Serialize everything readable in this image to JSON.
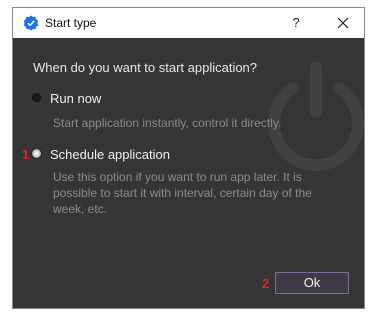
{
  "window": {
    "title": "Start type",
    "help_label": "?"
  },
  "dialog": {
    "question": "When do you want to start application?",
    "options": [
      {
        "label": "Run now",
        "description": "Start  application instantly, control it directly.",
        "selected": false
      },
      {
        "label": "Schedule application",
        "description": "Use this option if you want to run app later. It is possible to start it with interval, certain day of the week, etc.",
        "selected": true
      }
    ],
    "ok_label": "Ok"
  },
  "markers": {
    "marker1": "1",
    "marker2": "2"
  },
  "colors": {
    "background": "#353535",
    "title_icon": "#1e73e8",
    "marker": "#d8282c",
    "ok_border": "#7d6f96"
  },
  "icons": {
    "title": "checkmark-shield-icon",
    "close": "close-icon",
    "watermark": "power-icon"
  }
}
